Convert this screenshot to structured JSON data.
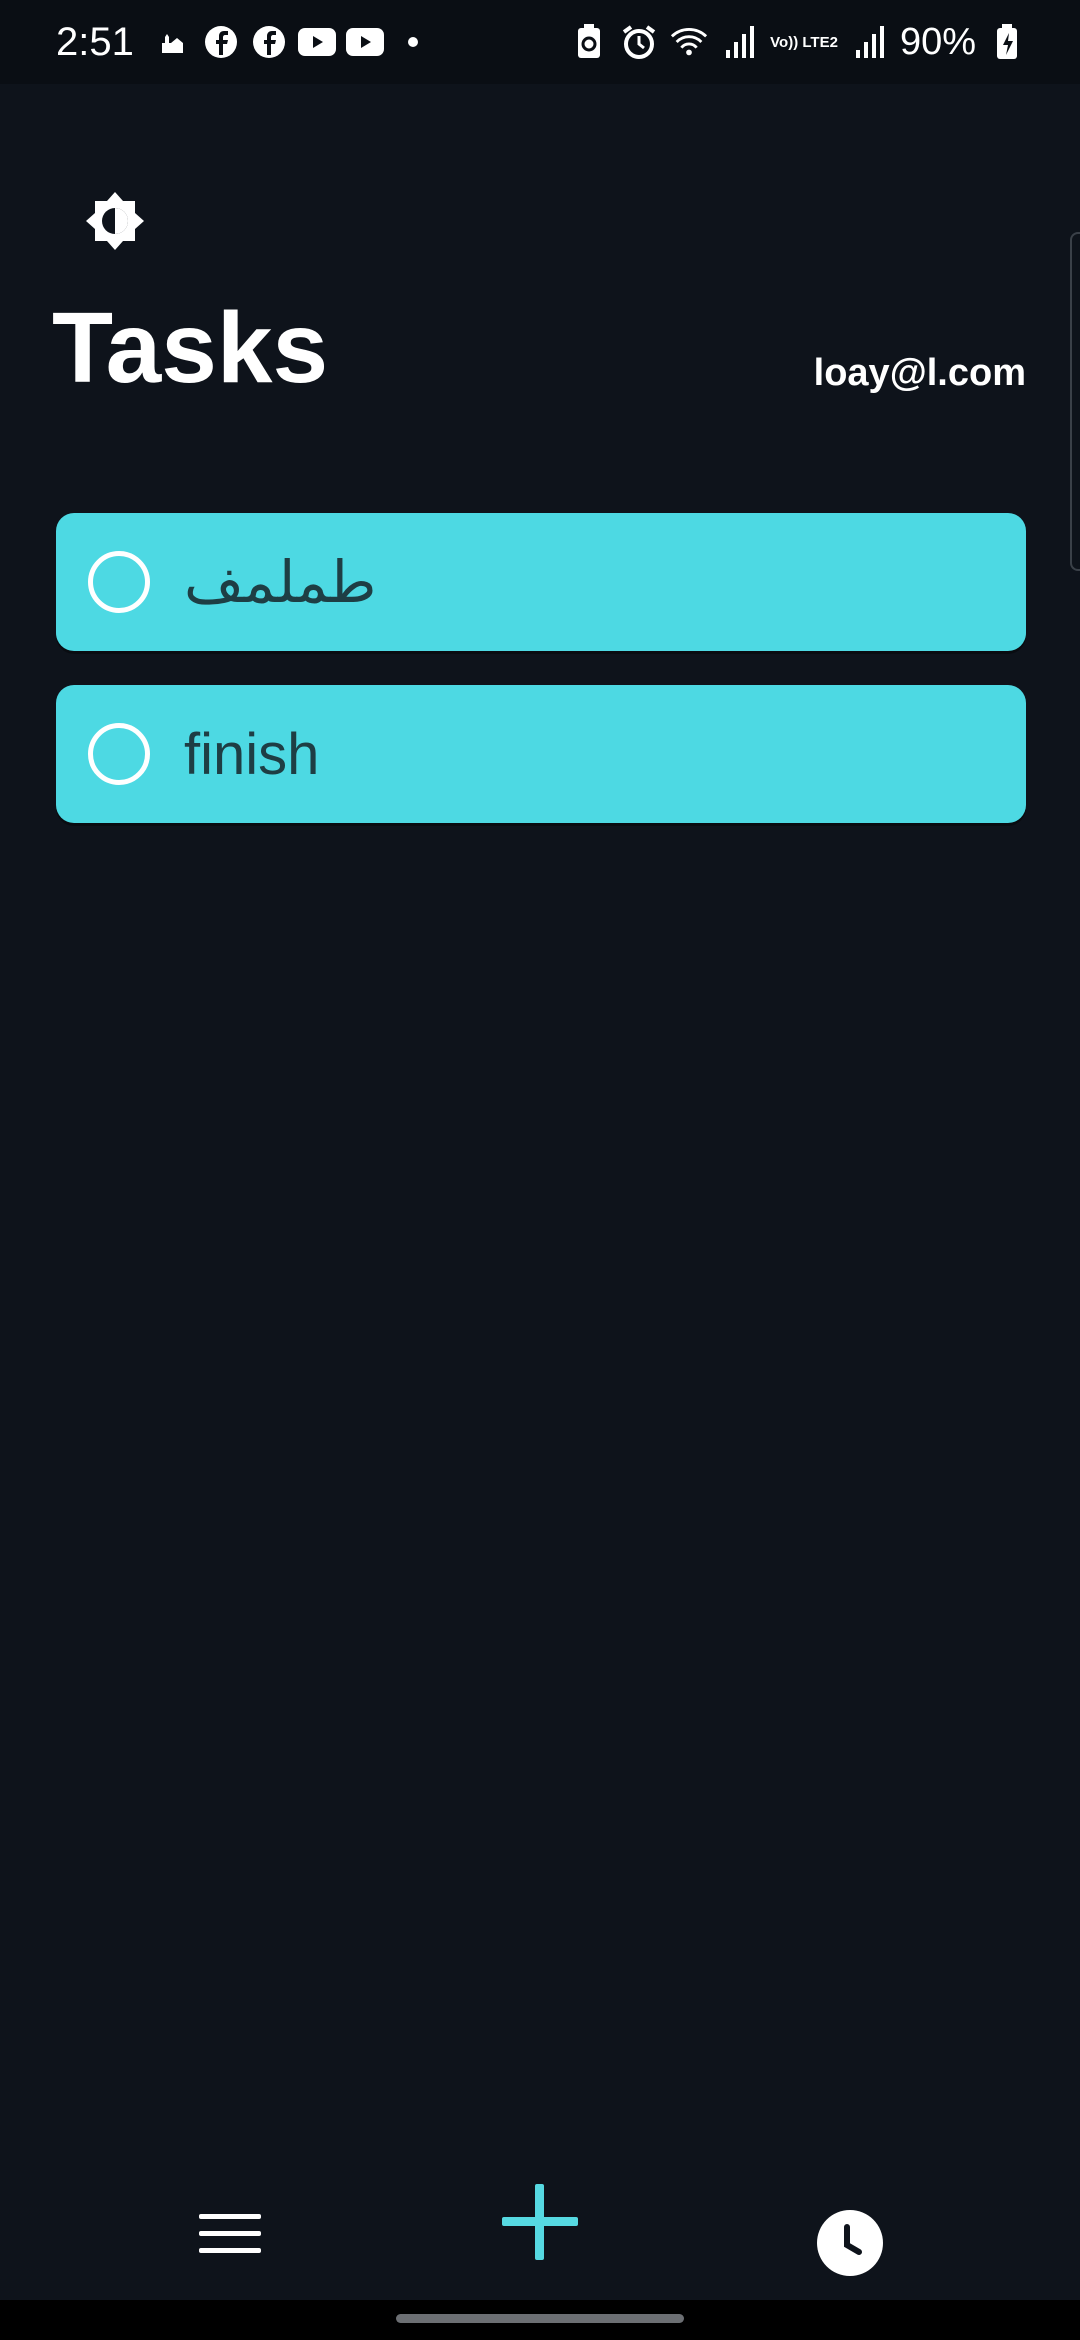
{
  "status_bar": {
    "time": "2:51",
    "battery": "90%",
    "network": "Vo)) LTE2",
    "left_icons": [
      "mosque-icon",
      "facebook-icon",
      "facebook-icon",
      "youtube-icon",
      "youtube-icon",
      "notification-dot-icon"
    ],
    "right_icons": [
      "battery-saver-icon",
      "alarm-icon",
      "wifi-icon",
      "signal-icon",
      "lte-icon",
      "signal-icon",
      "battery-charging-icon"
    ]
  },
  "header": {
    "theme_toggle_icon": "brightness-icon",
    "title": "Tasks",
    "user_email": "loay@l.com"
  },
  "tasks": [
    {
      "label": "طملمف",
      "completed": false
    },
    {
      "label": "finish",
      "completed": false
    }
  ],
  "bottom_nav": {
    "items": [
      {
        "icon": "menu-icon"
      },
      {
        "icon": "add-icon"
      },
      {
        "icon": "clock-icon"
      }
    ]
  },
  "colors": {
    "background": "#0e131b",
    "task_card": "#4dd9e3",
    "task_text": "#1e3e44",
    "accent": "#56d9e2"
  }
}
